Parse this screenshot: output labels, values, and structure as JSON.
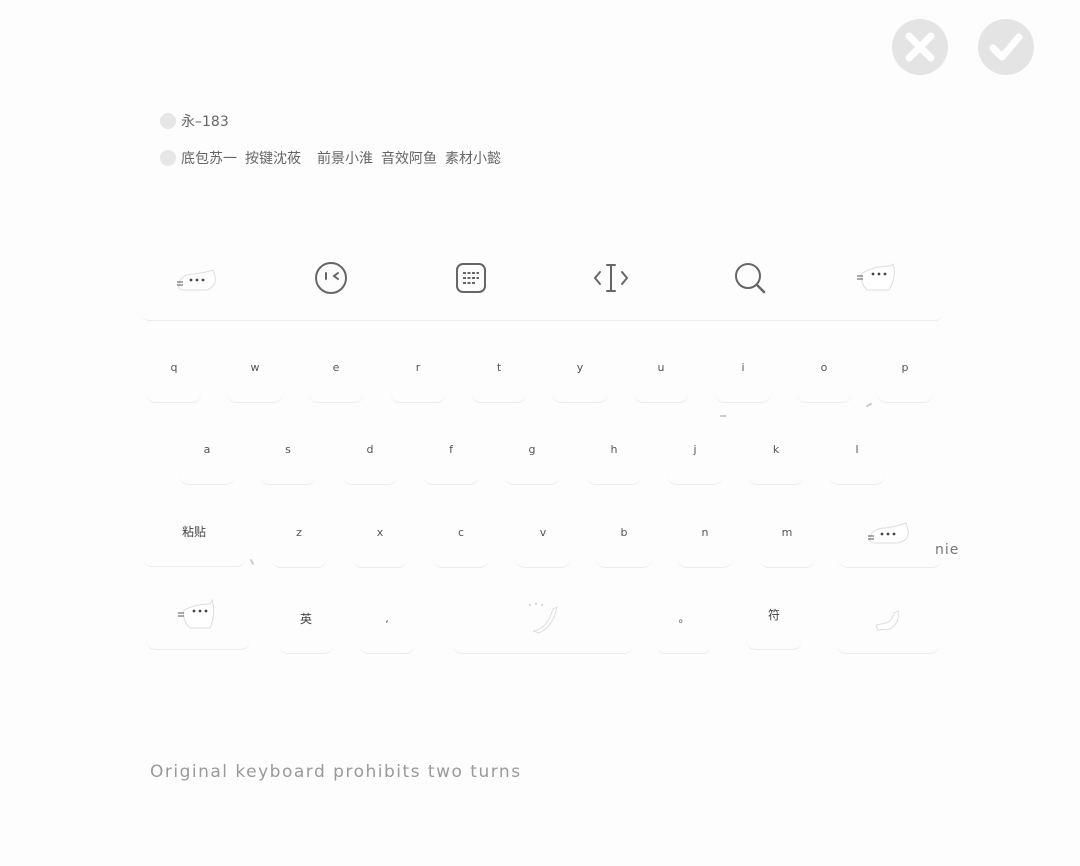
{
  "top_buttons": {
    "cancel_icon": "close-icon",
    "confirm_icon": "check-icon"
  },
  "credits": {
    "line1": "永–183",
    "line2_parts": [
      "底包苏一",
      "按键沈莜",
      "前景小淮",
      "音效阿鱼",
      "素材小懿"
    ]
  },
  "toolbar": {
    "items": [
      "cat-sticker-icon",
      "emoji-icon",
      "clipboard-icon",
      "cursor-move-icon",
      "search-icon",
      "cat-sticker-icon"
    ]
  },
  "keyboard": {
    "row1": [
      "q",
      "w",
      "e",
      "r",
      "t",
      "y",
      "u",
      "i",
      "o",
      "p"
    ],
    "row2": [
      "a",
      "s",
      "d",
      "f",
      "g",
      "h",
      "j",
      "k",
      "l"
    ],
    "row3": {
      "paste": "粘贴",
      "letters": [
        "z",
        "x",
        "c",
        "v",
        "b",
        "n",
        "m"
      ]
    },
    "row4": {
      "lang": "英",
      "comma": ",",
      "period": "。",
      "symbols": "符"
    }
  },
  "composing_text": "nie",
  "footer": "Original keyboard prohibits two turns",
  "colors": {
    "background": "#fdfdfd",
    "button_bg": "#e4e4e4",
    "key_text": "#555555"
  }
}
